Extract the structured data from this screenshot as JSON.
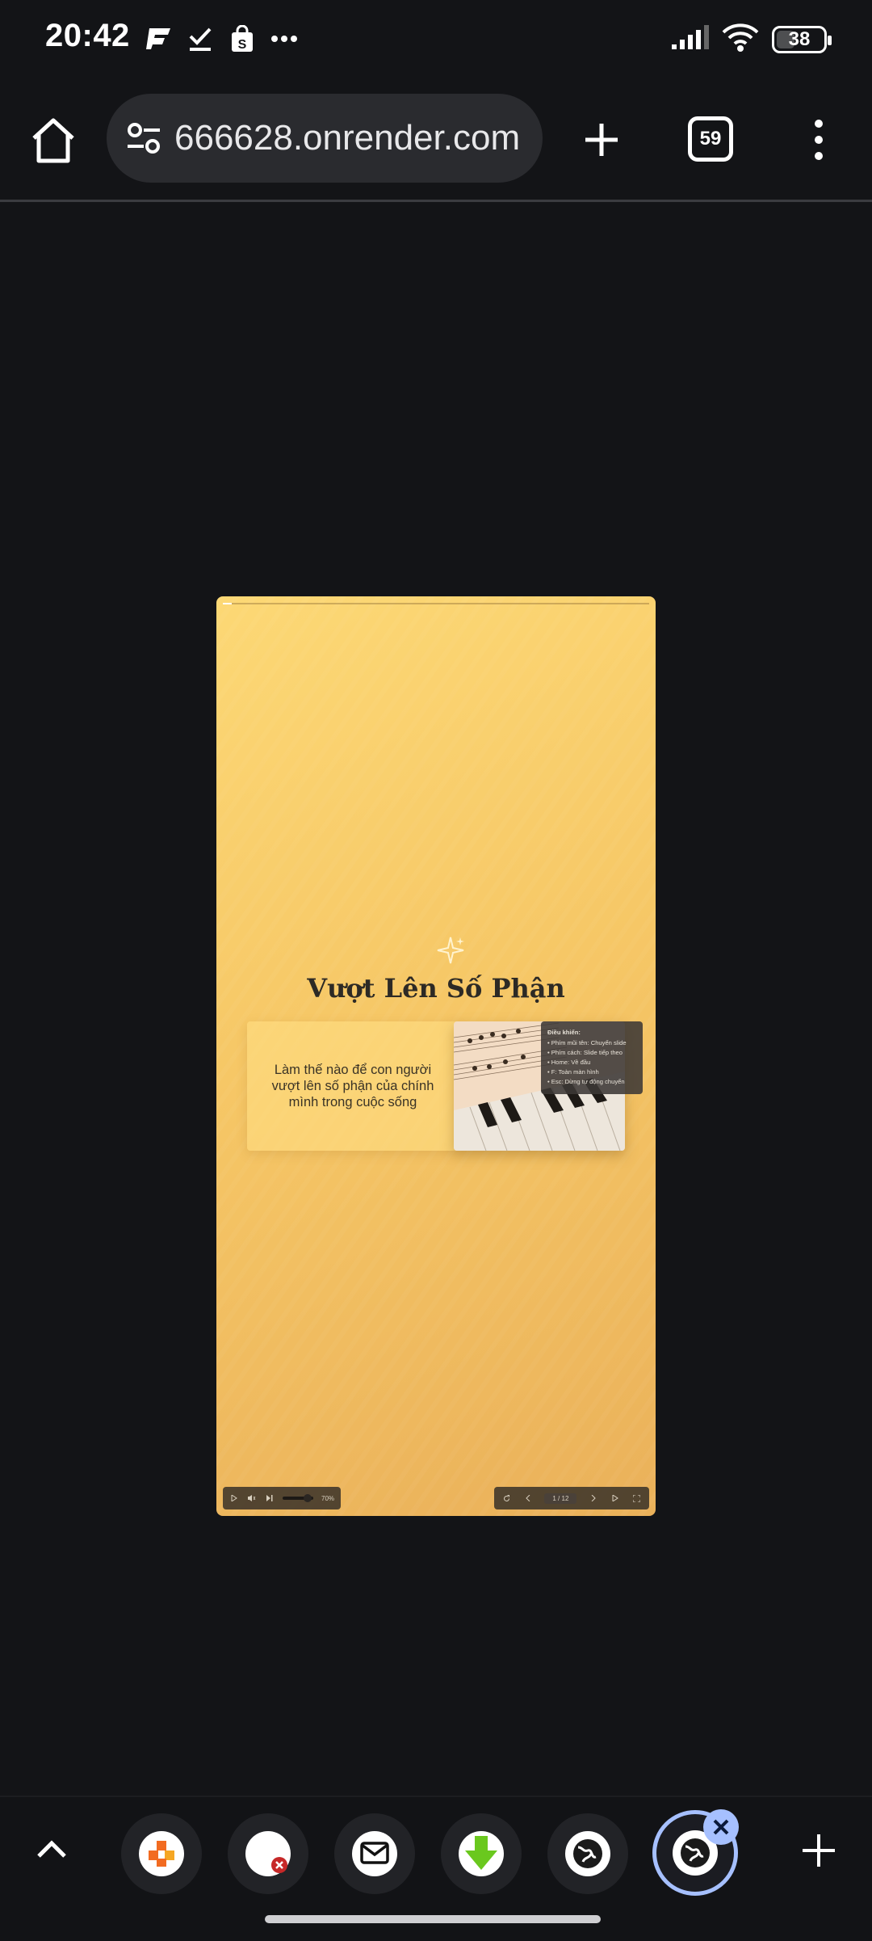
{
  "status_bar": {
    "time": "20:42",
    "notification_icons": [
      "flipboard-icon",
      "task-check-icon",
      "shopping-bag-icon",
      "more-dots-icon"
    ],
    "battery": "38"
  },
  "browser": {
    "url": "666628.onrender.com",
    "tab_count": "59"
  },
  "slide": {
    "title": "Vượt Lên Số Phận",
    "subtitle": "Làm thế nào để con người vượt lên số phận của chính mình trong cuộc sống",
    "help": {
      "heading": "Điều khiển:",
      "lines": [
        "• Phím mũi tên: Chuyển slide",
        "• Phím cách: Slide tiếp theo",
        "• Home: Về đầu",
        "• F: Toàn màn hình",
        "• Esc: Dừng tự động chuyển"
      ]
    },
    "volume_label": "70%",
    "counter": "1 / 12",
    "volume_level": 0.7
  },
  "bottom_tabs": [
    {
      "icon": "orange-pinwheel-icon"
    },
    {
      "icon": "blocked-site-icon"
    },
    {
      "icon": "mail-icon"
    },
    {
      "icon": "green-download-icon"
    },
    {
      "icon": "globe-icon"
    },
    {
      "icon": "globe-icon",
      "active": true
    }
  ],
  "colors": {
    "background": "#131417",
    "accent": "#a6c0ff",
    "slide_top": "#fcd875",
    "slide_bottom": "#eab15a"
  }
}
